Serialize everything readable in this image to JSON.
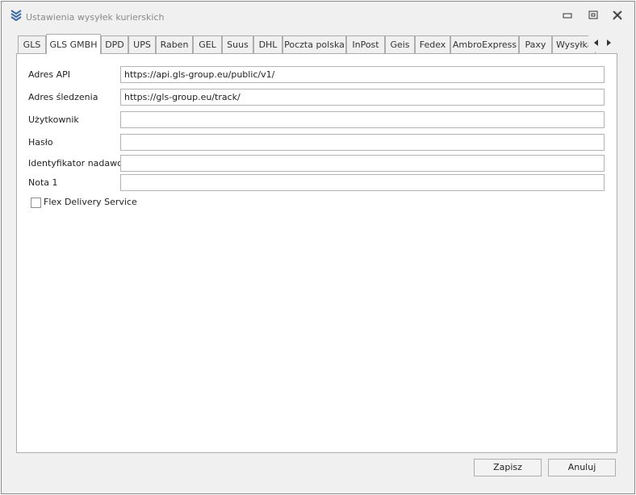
{
  "window": {
    "title": "Ustawienia wysyłek kurierskich"
  },
  "tabs": [
    {
      "label": "GLS"
    },
    {
      "label": "GLS GMBH",
      "active": true
    },
    {
      "label": "DPD"
    },
    {
      "label": "UPS"
    },
    {
      "label": "Raben"
    },
    {
      "label": "GEL"
    },
    {
      "label": "Suus"
    },
    {
      "label": "DHL"
    },
    {
      "label": "Poczta polska"
    },
    {
      "label": "InPost"
    },
    {
      "label": "Geis"
    },
    {
      "label": "Fedex"
    },
    {
      "label": "AmbroExpress"
    },
    {
      "label": "Paxy"
    },
    {
      "label": "Wysyłka"
    }
  ],
  "form": {
    "fields": [
      {
        "label": "Adres API",
        "value": "https://api.gls-group.eu/public/v1/"
      },
      {
        "label": "Adres śledzenia",
        "value": "https://gls-group.eu/track/"
      },
      {
        "label": "Użytkownik",
        "value": ""
      },
      {
        "label": "Hasło",
        "value": ""
      },
      {
        "label": "Identyfikator nadawcy",
        "value": ""
      },
      {
        "label": "Nota 1",
        "value": ""
      }
    ],
    "flex_label": "Flex Delivery Service",
    "flex_checked": false
  },
  "buttons": {
    "save_label": "Zapisz",
    "cancel_label": "Anuluj"
  },
  "colors": {
    "window_bg": "#f0f0f0",
    "panel_bg": "#ffffff",
    "border": "#adadad",
    "title_text": "#8a8a8a"
  }
}
